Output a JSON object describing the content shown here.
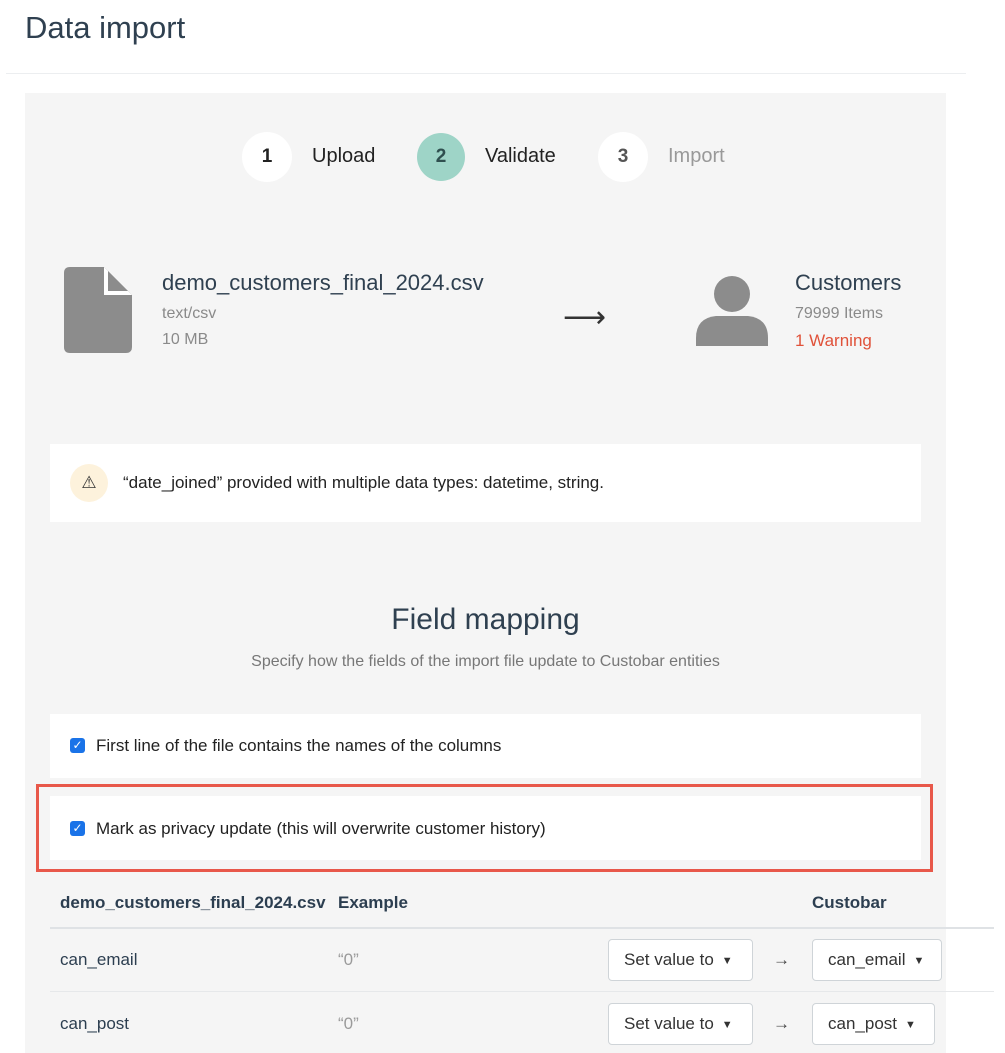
{
  "page": {
    "title": "Data import"
  },
  "steps": [
    {
      "number": "1",
      "label": "Upload",
      "state": "done"
    },
    {
      "number": "2",
      "label": "Validate",
      "state": "active"
    },
    {
      "number": "3",
      "label": "Import",
      "state": "pending"
    }
  ],
  "source_file": {
    "name": "demo_customers_final_2024.csv",
    "type": "text/csv",
    "size": "10 MB",
    "icon": "file-icon"
  },
  "arrow": "⟶",
  "target": {
    "name": "Customers",
    "count": "79999 Items",
    "warnings": "1 Warning",
    "icon": "user-icon"
  },
  "warning": {
    "icon": "⚠",
    "text": "“date_joined” provided with multiple data types: datetime, string."
  },
  "mapping": {
    "title": "Field mapping",
    "subtitle": "Specify how the fields of the import file update to Custobar entities",
    "options": [
      {
        "label": "First line of the file contains the names of the columns",
        "checked": true
      },
      {
        "label": "Mark as privacy update (this will overwrite customer history)",
        "checked": true
      }
    ],
    "columns": {
      "file": "demo_customers_final_2024.csv",
      "example": "Example",
      "custobar": "Custobar"
    },
    "rows": [
      {
        "field": "can_email",
        "example": "“0”",
        "action": "Set value to",
        "arrow": "→",
        "target": "can_email"
      },
      {
        "field": "can_post",
        "example": "“0”",
        "action": "Set value to",
        "arrow": "→",
        "target": "can_post"
      }
    ]
  },
  "colors": {
    "active_step": "#9ed4c7",
    "warning_text": "#e0523a",
    "highlight_border": "#e8584a",
    "checkbox": "#1a73e8"
  }
}
